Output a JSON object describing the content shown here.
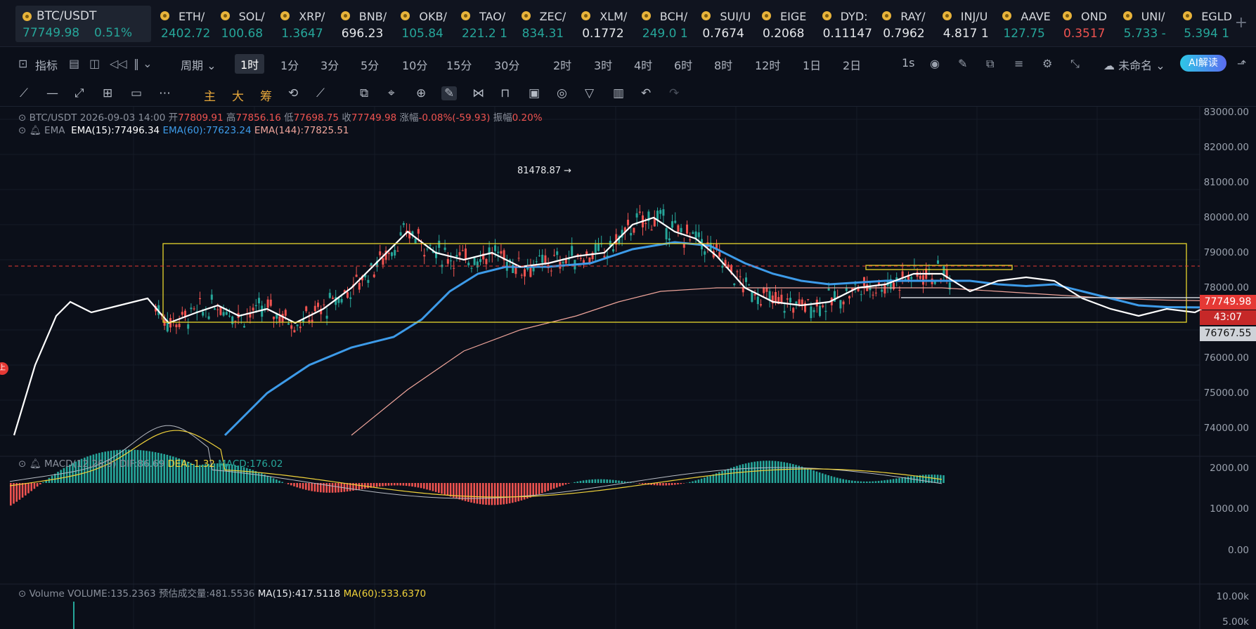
{
  "tickers": [
    {
      "name": "BTC/USDT",
      "price": "77749.98",
      "change": "0.51%",
      "dir": "green",
      "main": true
    },
    {
      "name": "ETH/",
      "price": "2402.72",
      "dir": "green"
    },
    {
      "name": "SOL/",
      "price": "100.68",
      "dir": "green"
    },
    {
      "name": "XRP/",
      "price": "1.3647",
      "dir": "green"
    },
    {
      "name": "BNB/",
      "price": "696.23",
      "dir": "white"
    },
    {
      "name": "OKB/",
      "price": "105.84",
      "dir": "green"
    },
    {
      "name": "TAO/",
      "price": "221.2 1",
      "dir": "green"
    },
    {
      "name": "ZEC/",
      "price": "834.31",
      "dir": "green"
    },
    {
      "name": "XLM/",
      "price": "0.1772",
      "dir": "white"
    },
    {
      "name": "BCH/",
      "price": "249.0 1",
      "dir": "green"
    },
    {
      "name": "SUI/U",
      "price": "0.7674",
      "dir": "white"
    },
    {
      "name": "EIGE",
      "price": "0.2068",
      "dir": "white"
    },
    {
      "name": "DYD:",
      "price": "0.11147",
      "dir": "white"
    },
    {
      "name": "RAY/",
      "price": "0.7962",
      "dir": "white"
    },
    {
      "name": "INJ/U",
      "price": "4.817 1",
      "dir": "white"
    },
    {
      "name": "AAVE",
      "price": "127.75",
      "dir": "green"
    },
    {
      "name": "OND",
      "price": "0.3517",
      "dir": "red"
    },
    {
      "name": "UNI/",
      "price": "5.733 -",
      "dir": "green"
    },
    {
      "name": "EGLD",
      "price": "5.394 1",
      "dir": "green"
    }
  ],
  "toolbar": {
    "indicators": "指标",
    "period_label": "周期",
    "periods": [
      "1时",
      "1分",
      "3分",
      "5分",
      "10分",
      "15分",
      "30分",
      "2时",
      "3时",
      "4时",
      "6时",
      "8时",
      "12时",
      "1日",
      "2日"
    ],
    "active_period": "1时",
    "interval": "1s",
    "layout_name": "未命名",
    "ai_button": "AI解读"
  },
  "draw_tools": {
    "main": "主",
    "big": "大",
    "chips": "筹"
  },
  "legend": {
    "symbol": "BTC/USDT",
    "datetime": "2026-09-03 14:00",
    "open_label": "开",
    "open": "77809.91",
    "high_label": "高",
    "high": "77856.16",
    "low_label": "低",
    "low": "77698.75",
    "close_label": "收",
    "close": "77749.98",
    "chg_label": "涨幅",
    "chg": "-0.08%(-59.93)",
    "amp_label": "振幅",
    "amp": "0.20%",
    "ema_title": "EMA",
    "ema15": "EMA(15):77496.34",
    "ema60": "EMA(60):77623.24",
    "ema144": "EMA(144):77825.51",
    "macd_title": "MACD(12,26,9)",
    "dif": "DIF:86.69",
    "dea": "DEA:-1.32",
    "macd": "MACD:176.02",
    "vol_title": "Volume",
    "volume": "VOLUME:135.2363",
    "est_label": "预估成交量:",
    "est": "481.5536",
    "ma15": "MA(15):417.5118",
    "ma60": "MA(60):533.6370"
  },
  "annotations": {
    "high_marker": "81478.87 →",
    "side_badge": "上"
  },
  "price_tags": {
    "last": "77749.98",
    "countdown": "43:07",
    "line": "76767.55"
  },
  "price_axis": [
    "83000.00",
    "82000.00",
    "81000.00",
    "80000.00",
    "79000.00",
    "78000.00",
    "76000.00",
    "75000.00",
    "74000.00"
  ],
  "macd_axis": [
    "2000.00",
    "1000.00",
    "0.00"
  ],
  "vol_axis": [
    "10.00k",
    "5.00k"
  ],
  "colors": {
    "up": "#26a69a",
    "down": "#ef5350",
    "ema15": "#ffffff",
    "ema60": "#3d9be9",
    "ema144": "#f0a59b",
    "box": "#e8d52c",
    "dea": "#f0d23a"
  },
  "chart_data": {
    "type": "candlestick",
    "range_high": 81478.87,
    "ema15_path": [
      [
        0,
        74000
      ],
      [
        30,
        76000
      ],
      [
        60,
        77400
      ],
      [
        80,
        77800
      ],
      [
        110,
        77500
      ],
      [
        150,
        77700
      ],
      [
        190,
        77900
      ],
      [
        220,
        77200
      ],
      [
        260,
        77500
      ],
      [
        290,
        77700
      ],
      [
        320,
        77400
      ],
      [
        360,
        77600
      ],
      [
        400,
        77200
      ],
      [
        440,
        77600
      ],
      [
        480,
        78200
      ],
      [
        520,
        79000
      ],
      [
        560,
        79800
      ],
      [
        600,
        79200
      ],
      [
        640,
        79000
      ],
      [
        680,
        79200
      ],
      [
        720,
        78800
      ],
      [
        760,
        78900
      ],
      [
        800,
        79100
      ],
      [
        840,
        79200
      ],
      [
        880,
        80000
      ],
      [
        910,
        80200
      ],
      [
        940,
        79800
      ],
      [
        970,
        79600
      ],
      [
        1000,
        79100
      ],
      [
        1040,
        78200
      ],
      [
        1080,
        77800
      ],
      [
        1120,
        77700
      ],
      [
        1160,
        77800
      ],
      [
        1200,
        78200
      ],
      [
        1240,
        78300
      ],
      [
        1280,
        78600
      ],
      [
        1320,
        78600
      ],
      [
        1360,
        78100
      ],
      [
        1400,
        78400
      ],
      [
        1440,
        78500
      ],
      [
        1480,
        78400
      ],
      [
        1520,
        77900
      ],
      [
        1560,
        77600
      ],
      [
        1600,
        77400
      ],
      [
        1640,
        77600
      ],
      [
        1680,
        77500
      ],
      [
        1700,
        77700
      ]
    ],
    "ema60_path": [
      [
        300,
        74000
      ],
      [
        360,
        75200
      ],
      [
        420,
        76000
      ],
      [
        480,
        76500
      ],
      [
        540,
        76800
      ],
      [
        580,
        77300
      ],
      [
        620,
        78100
      ],
      [
        660,
        78600
      ],
      [
        700,
        78800
      ],
      [
        760,
        78800
      ],
      [
        820,
        78900
      ],
      [
        880,
        79300
      ],
      [
        940,
        79500
      ],
      [
        990,
        79400
      ],
      [
        1040,
        78900
      ],
      [
        1080,
        78600
      ],
      [
        1120,
        78400
      ],
      [
        1160,
        78300
      ],
      [
        1200,
        78350
      ],
      [
        1240,
        78400
      ],
      [
        1280,
        78400
      ],
      [
        1320,
        78400
      ],
      [
        1360,
        78400
      ],
      [
        1400,
        78300
      ],
      [
        1440,
        78250
      ],
      [
        1480,
        78300
      ],
      [
        1520,
        78100
      ],
      [
        1560,
        77900
      ],
      [
        1600,
        77700
      ],
      [
        1640,
        77650
      ],
      [
        1700,
        77640
      ]
    ],
    "ema144_path": [
      [
        480,
        74000
      ],
      [
        560,
        75300
      ],
      [
        640,
        76400
      ],
      [
        720,
        77000
      ],
      [
        800,
        77400
      ],
      [
        860,
        77800
      ],
      [
        920,
        78100
      ],
      [
        1000,
        78200
      ],
      [
        1080,
        78200
      ],
      [
        1160,
        78200
      ],
      [
        1240,
        78200
      ],
      [
        1320,
        78200
      ],
      [
        1400,
        78100
      ],
      [
        1480,
        78000
      ],
      [
        1560,
        77900
      ],
      [
        1640,
        77850
      ],
      [
        1700,
        77830
      ]
    ]
  }
}
